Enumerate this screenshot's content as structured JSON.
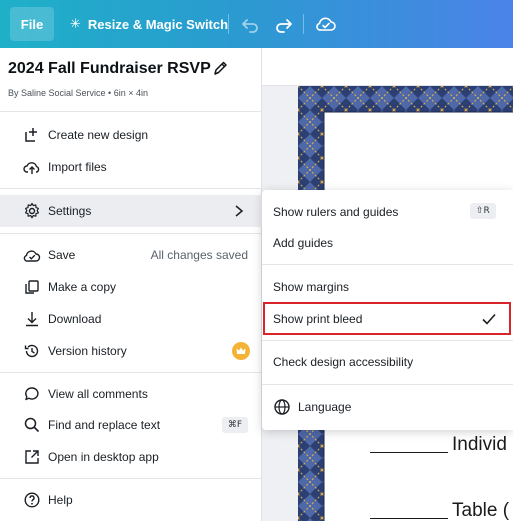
{
  "toolbar": {
    "file_label": "File",
    "resize_label": "Resize & Magic Switch",
    "resize_icon": "sparkle-icon",
    "undo_icon": "undo-icon",
    "redo_icon": "redo-icon",
    "cloud_icon": "cloud-check-icon"
  },
  "file_menu": {
    "design_title": "2024 Fall Fundraiser RSVP",
    "design_meta": "By Saline Social Service • 6in × 4in",
    "items": [
      {
        "label": "Create new design",
        "icon": "plus-square-icon"
      },
      {
        "label": "Import files",
        "icon": "cloud-upload-icon"
      },
      {
        "label": "Settings",
        "icon": "gear-icon"
      },
      {
        "label": "Save",
        "icon": "cloud-check-icon",
        "aside": "All changes saved"
      },
      {
        "label": "Make a copy",
        "icon": "copy-icon"
      },
      {
        "label": "Download",
        "icon": "download-icon"
      },
      {
        "label": "Version history",
        "icon": "history-icon"
      },
      {
        "label": "View all comments",
        "icon": "comment-icon"
      },
      {
        "label": "Find and replace text",
        "icon": "search-icon",
        "shortcut": "⌘F"
      },
      {
        "label": "Open in desktop app",
        "icon": "external-link-icon"
      },
      {
        "label": "Help",
        "icon": "help-icon"
      }
    ]
  },
  "settings_menu": {
    "items": [
      {
        "label": "Show rulers and guides",
        "shortcut": "⇧R"
      },
      {
        "label": "Add guides"
      },
      {
        "label": "Show margins"
      },
      {
        "label": "Show print bleed",
        "checked": true
      },
      {
        "label": "Check design accessibility"
      },
      {
        "label": "Language",
        "icon": "globe-icon"
      }
    ]
  },
  "canvas": {
    "line1": "Individ",
    "line2": "Table ("
  },
  "colors": {
    "toolbar_start": "#1fb0c8",
    "toolbar_end": "#4b83e8",
    "highlight": "#d9252a",
    "crown": "#f5b335"
  }
}
